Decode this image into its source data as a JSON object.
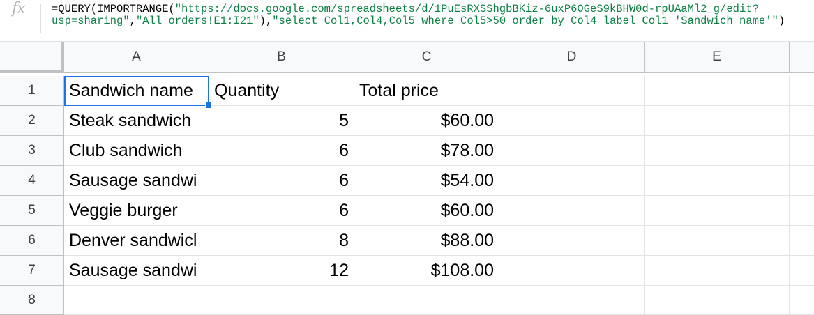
{
  "formula_bar": {
    "icon": "fx-icon",
    "line1_prefix": "=QUERY(IMPORTRANGE(",
    "line1_url": "\"https://docs.google.com/spreadsheets/d/1PuEsRXSShgbBKiz-6uxP6OGeS9kBHW0d-rpUAaMl2_g/edit?",
    "line2_url_end": "usp=sharing\"",
    "line2_sep1": ",",
    "line2_range": "\"All orders!E1:I21\"",
    "line2_sep2": "),",
    "line2_query": "\"select Col1,Col4,Col5 where Col5>50 order by Col4 label Col1 'Sandwich name'\"",
    "line2_suffix": ")"
  },
  "columns": [
    "A",
    "B",
    "C",
    "D",
    "E"
  ],
  "rows": [
    "1",
    "2",
    "3",
    "4",
    "5",
    "6",
    "7",
    "8"
  ],
  "cells": [
    [
      "Sandwich name",
      "Quantity",
      "Total price",
      "",
      ""
    ],
    [
      "Steak sandwich",
      "5",
      "$60.00",
      "",
      ""
    ],
    [
      "Club sandwich",
      "6",
      "$78.00",
      "",
      ""
    ],
    [
      "Sausage sandwi",
      "6",
      "$54.00",
      "",
      ""
    ],
    [
      "Veggie burger",
      "6",
      "$60.00",
      "",
      ""
    ],
    [
      "Denver sandwicl",
      "8",
      "$88.00",
      "",
      ""
    ],
    [
      "Sausage sandwi",
      "12",
      "$108.00",
      "",
      ""
    ],
    [
      "",
      "",
      "",
      "",
      ""
    ]
  ],
  "colors": {
    "selection": "#1a73e8",
    "string_literal": "#0b8043",
    "header_bg": "#f8f9fa"
  }
}
